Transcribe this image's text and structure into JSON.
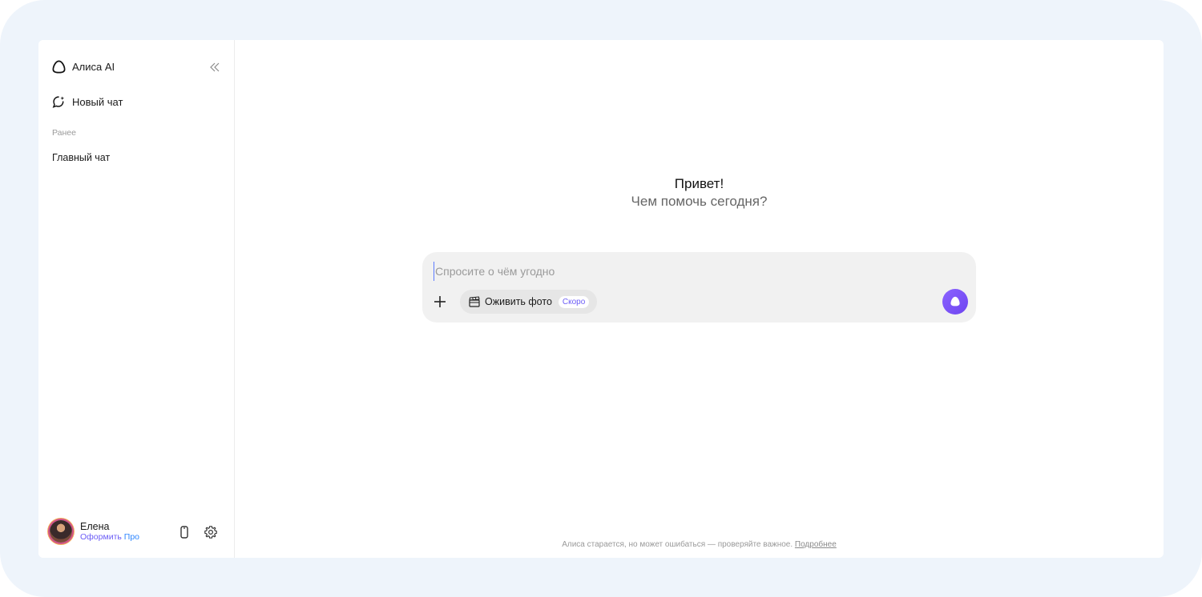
{
  "sidebar": {
    "brand": "Алиса AI",
    "new_chat": "Новый чат",
    "section_label": "Ранее",
    "chats": [
      "Главный чат"
    ],
    "user": {
      "name": "Елена",
      "pro_prefix": "Оформить ",
      "pro_suffix": "Про"
    }
  },
  "main": {
    "greeting": "Привет!",
    "subtitle": "Чем помочь сегодня?",
    "composer": {
      "placeholder": "Спросите о чём угодно",
      "chip_label": "Оживить фото",
      "chip_badge": "Скоро"
    },
    "footer": {
      "text": "Алиса старается, но может ошибаться — проверяйте важное.",
      "link": "Подробнее"
    }
  },
  "colors": {
    "accent": "#6e45f0",
    "frame_bg": "#eef4fb",
    "composer_bg": "#f1f1f1"
  },
  "icons": [
    "alice-logo-icon",
    "collapse-sidebar-icon",
    "new-chat-icon",
    "phone-icon",
    "settings-gear-icon",
    "plus-icon",
    "clapperboard-icon",
    "alice-send-icon"
  ]
}
